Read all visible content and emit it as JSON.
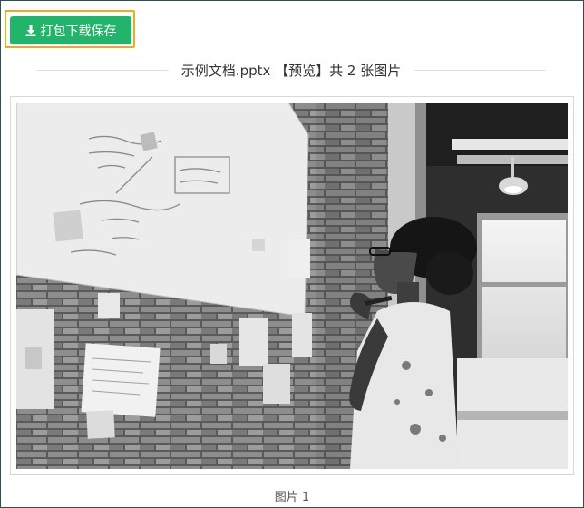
{
  "toolbar": {
    "download_label": "打包下载保存",
    "download_icon": "download-icon"
  },
  "preview": {
    "title": "示例文档.pptx 【预览】共 2 张图片"
  },
  "images": [
    {
      "caption": "图片 1"
    }
  ],
  "colors": {
    "button_bg": "#22b46b",
    "highlight_border": "#f2a922"
  }
}
